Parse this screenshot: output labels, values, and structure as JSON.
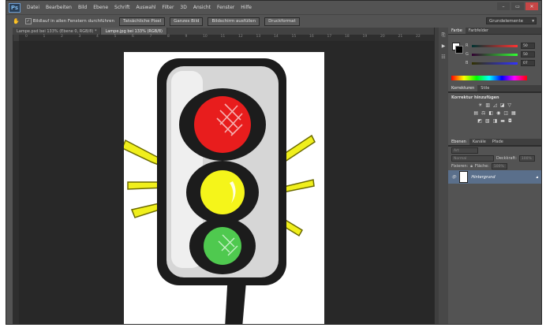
{
  "menu": {
    "logo": "Ps",
    "items": [
      "Datei",
      "Bearbeiten",
      "Bild",
      "Ebene",
      "Schrift",
      "Auswahl",
      "Filter",
      "3D",
      "Ansicht",
      "Fenster",
      "Hilfe"
    ]
  },
  "window_controls": {
    "minimize": "–",
    "restore": "▭",
    "close": "✕"
  },
  "options": {
    "checkbox_label": "Bildlauf in allen Fenstern durchführen",
    "buttons": [
      "Tatsächliche Pixel",
      "Ganzes Bild",
      "Bildschirm ausfüllen",
      "Druckformat"
    ],
    "workspace": "Grundelemente"
  },
  "tabs": [
    {
      "label": "Lampe.psd bei 133% (Ebene 0, RGB/8) *",
      "active": false
    },
    {
      "label": "Lampe.jpg bei 133% (RGB/8)",
      "active": true
    }
  ],
  "ruler_h": [
    "0",
    "1",
    "2",
    "3",
    "4",
    "5",
    "6",
    "7",
    "8",
    "9",
    "10",
    "11",
    "12",
    "13",
    "14",
    "15",
    "16",
    "17",
    "18",
    "19",
    "20",
    "21",
    "22"
  ],
  "panels": {
    "color": {
      "tabs": [
        "Farbe",
        "Farbfelder"
      ],
      "sliders": [
        {
          "label": "R",
          "value": "50"
        },
        {
          "label": "G",
          "value": "50"
        },
        {
          "label": "B",
          "value": "07"
        }
      ]
    },
    "adjustments": {
      "tabs": [
        "Korrekturen",
        "Stile"
      ],
      "title": "Korrektur hinzufügen"
    },
    "layers": {
      "tabs": [
        "Ebenen",
        "Kanäle",
        "Pfade"
      ],
      "kind": "Art",
      "blend_mode": "Normal",
      "opacity_label": "Deckkraft:",
      "opacity_value": "100%",
      "lock_label": "Fixieren:",
      "fill_label": "Fläche:",
      "fill_value": "100%",
      "layer_name": "Hintergrund"
    }
  },
  "document": {
    "image": "traffic-light",
    "colors": {
      "red": "#e81d1d",
      "yellow": "#f5f51a",
      "green": "#4fc94f",
      "housing": "#1c1c1c",
      "face": "#d6d6d6"
    }
  }
}
